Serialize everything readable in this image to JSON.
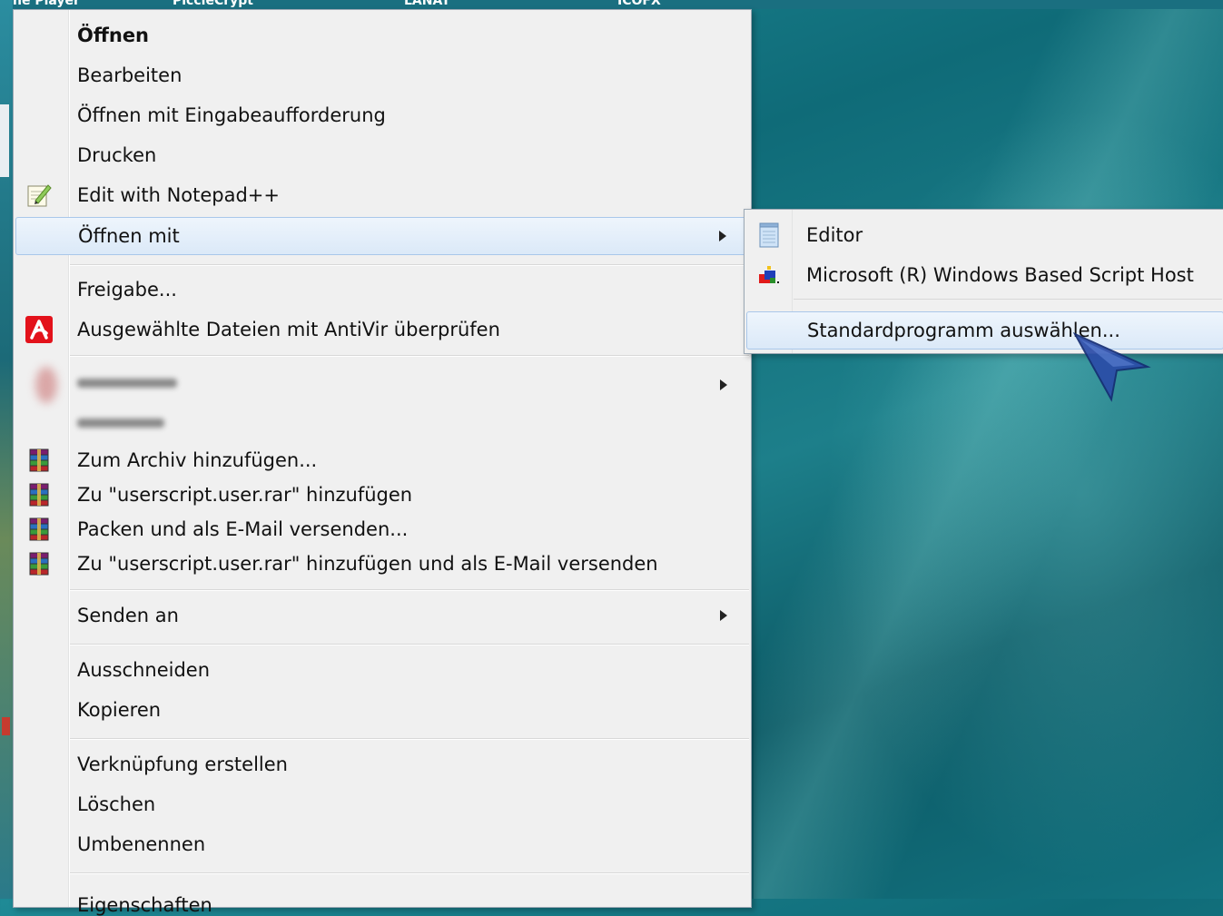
{
  "desktop": {
    "top_labels": [
      "ne Player",
      "PiccleCrypt",
      "LANAT",
      "ICOFX"
    ]
  },
  "menu": {
    "items": [
      {
        "label": "Öffnen",
        "bold": true
      },
      {
        "label": "Bearbeiten"
      },
      {
        "label": "Öffnen mit Eingabeaufforderung"
      },
      {
        "label": "Drucken"
      },
      {
        "label": "Edit with Notepad++",
        "icon": "notepad-plus-plus-icon"
      },
      {
        "label": "Öffnen mit",
        "submenu": true,
        "selected": true
      },
      {
        "label": "Freigabe..."
      },
      {
        "label": "Ausgewählte Dateien mit AntiVir überprüfen",
        "icon": "antivir-icon"
      },
      {
        "label": "",
        "blurred": true,
        "submenu": true
      },
      {
        "label": "",
        "blurred": true
      },
      {
        "label": "Zum Archiv hinzufügen...",
        "icon": "winrar-icon"
      },
      {
        "label": "Zu \"userscript.user.rar\" hinzufügen",
        "icon": "winrar-icon"
      },
      {
        "label": "Packen und als E-Mail versenden...",
        "icon": "winrar-icon"
      },
      {
        "label": "Zu \"userscript.user.rar\" hinzufügen und als E-Mail versenden",
        "icon": "winrar-icon"
      },
      {
        "label": "Senden an",
        "submenu": true
      },
      {
        "label": "Ausschneiden"
      },
      {
        "label": "Kopieren"
      },
      {
        "label": "Verknüpfung erstellen"
      },
      {
        "label": "Löschen"
      },
      {
        "label": "Umbenennen"
      },
      {
        "label": "Eigenschaften"
      }
    ]
  },
  "submenu": {
    "items": [
      {
        "label": "Editor",
        "icon": "notepad-icon"
      },
      {
        "label": "Microsoft (R) Windows Based Script Host",
        "icon": "script-host-icon"
      },
      {
        "label": "Standardprogramm auswählen...",
        "selected": true
      }
    ]
  },
  "colors": {
    "menu_bg": "#f0f0f0",
    "selection_border": "#a9c7ea",
    "selection_bg": "#dbe9f8",
    "desktop": "#137380"
  }
}
